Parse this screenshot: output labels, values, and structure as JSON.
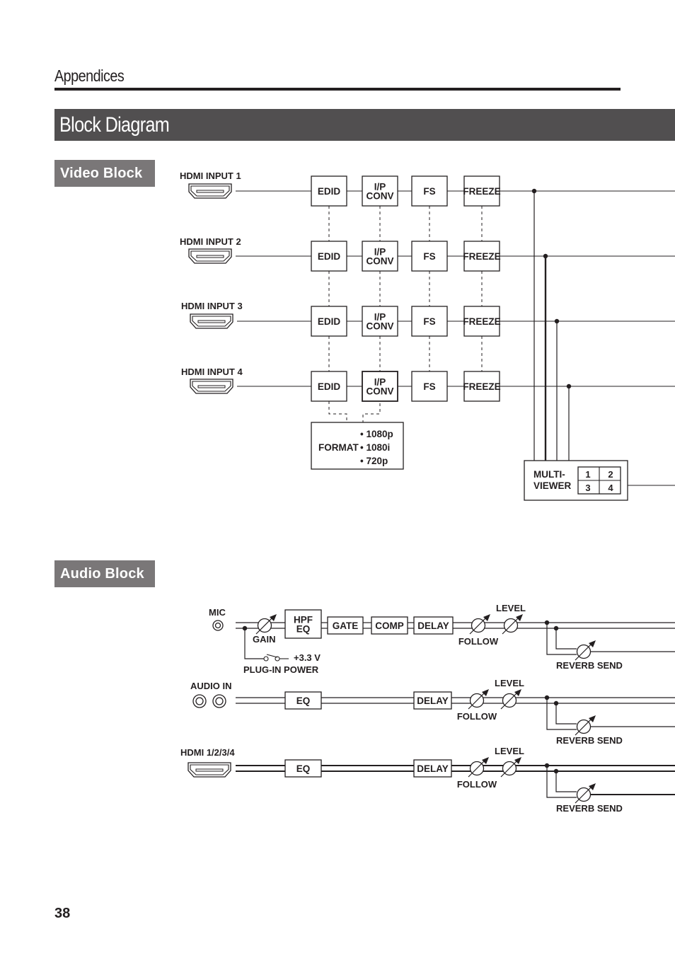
{
  "page": {
    "section_header": "Appendices",
    "title": "Block Diagram",
    "page_number": "38"
  },
  "video_block": {
    "tag": "Video Block",
    "inputs": [
      {
        "label": "HDMI  INPUT 1",
        "icon": "hdmi-connector-icon"
      },
      {
        "label": "HDMI  INPUT 2",
        "icon": "hdmi-connector-icon"
      },
      {
        "label": "HDMI  INPUT 3",
        "icon": "hdmi-connector-icon"
      },
      {
        "label": "HDMI  INPUT 4",
        "icon": "hdmi-connector-icon"
      }
    ],
    "processing_blocks": [
      {
        "id": "edid",
        "lines": [
          "EDID"
        ]
      },
      {
        "id": "ip-conv",
        "lines": [
          "I/P",
          "CONV"
        ]
      },
      {
        "id": "fs",
        "lines": [
          "FS"
        ]
      },
      {
        "id": "freeze",
        "lines": [
          "FREEZE"
        ]
      }
    ],
    "format_box": {
      "label": "FORMAT",
      "options": [
        "• 1080p",
        "• 1080i",
        "• 720p"
      ]
    },
    "multiviewer": {
      "lines": [
        "MULTI-",
        "VIEWER"
      ],
      "grid": [
        "1",
        "2",
        "3",
        "4"
      ]
    }
  },
  "audio_block": {
    "tag": "Audio Block",
    "channels": [
      {
        "id": "mic",
        "label": "MIC",
        "icon": "mic-jack-icon",
        "gain_label": "GAIN",
        "plugin_power_label": "PLUG-IN POWER",
        "voltage_label": "+3.3 V",
        "blocks": [
          {
            "id": "hpf-eq",
            "lines": [
              "HPF",
              "EQ"
            ]
          },
          {
            "id": "gate",
            "lines": [
              "GATE"
            ]
          },
          {
            "id": "comp",
            "lines": [
              "COMP"
            ]
          },
          {
            "id": "delay",
            "lines": [
              "DELAY"
            ]
          }
        ],
        "follow_label": "FOLLOW",
        "level_label": "LEVEL",
        "reverb_label": "REVERB SEND"
      },
      {
        "id": "audio-in",
        "label": "AUDIO IN",
        "icon": "rca-jack-icon",
        "blocks": [
          {
            "id": "eq",
            "lines": [
              "EQ"
            ]
          },
          {
            "id": "delay",
            "lines": [
              "DELAY"
            ]
          }
        ],
        "follow_label": "FOLLOW",
        "level_label": "LEVEL",
        "reverb_label": "REVERB SEND"
      },
      {
        "id": "hdmi",
        "label": "HDMI 1/2/3/4",
        "icon": "hdmi-connector-icon",
        "blocks": [
          {
            "id": "eq",
            "lines": [
              "EQ"
            ]
          },
          {
            "id": "delay",
            "lines": [
              "DELAY"
            ]
          }
        ],
        "follow_label": "FOLLOW",
        "level_label": "LEVEL",
        "reverb_label": "REVERB SEND"
      }
    ]
  }
}
